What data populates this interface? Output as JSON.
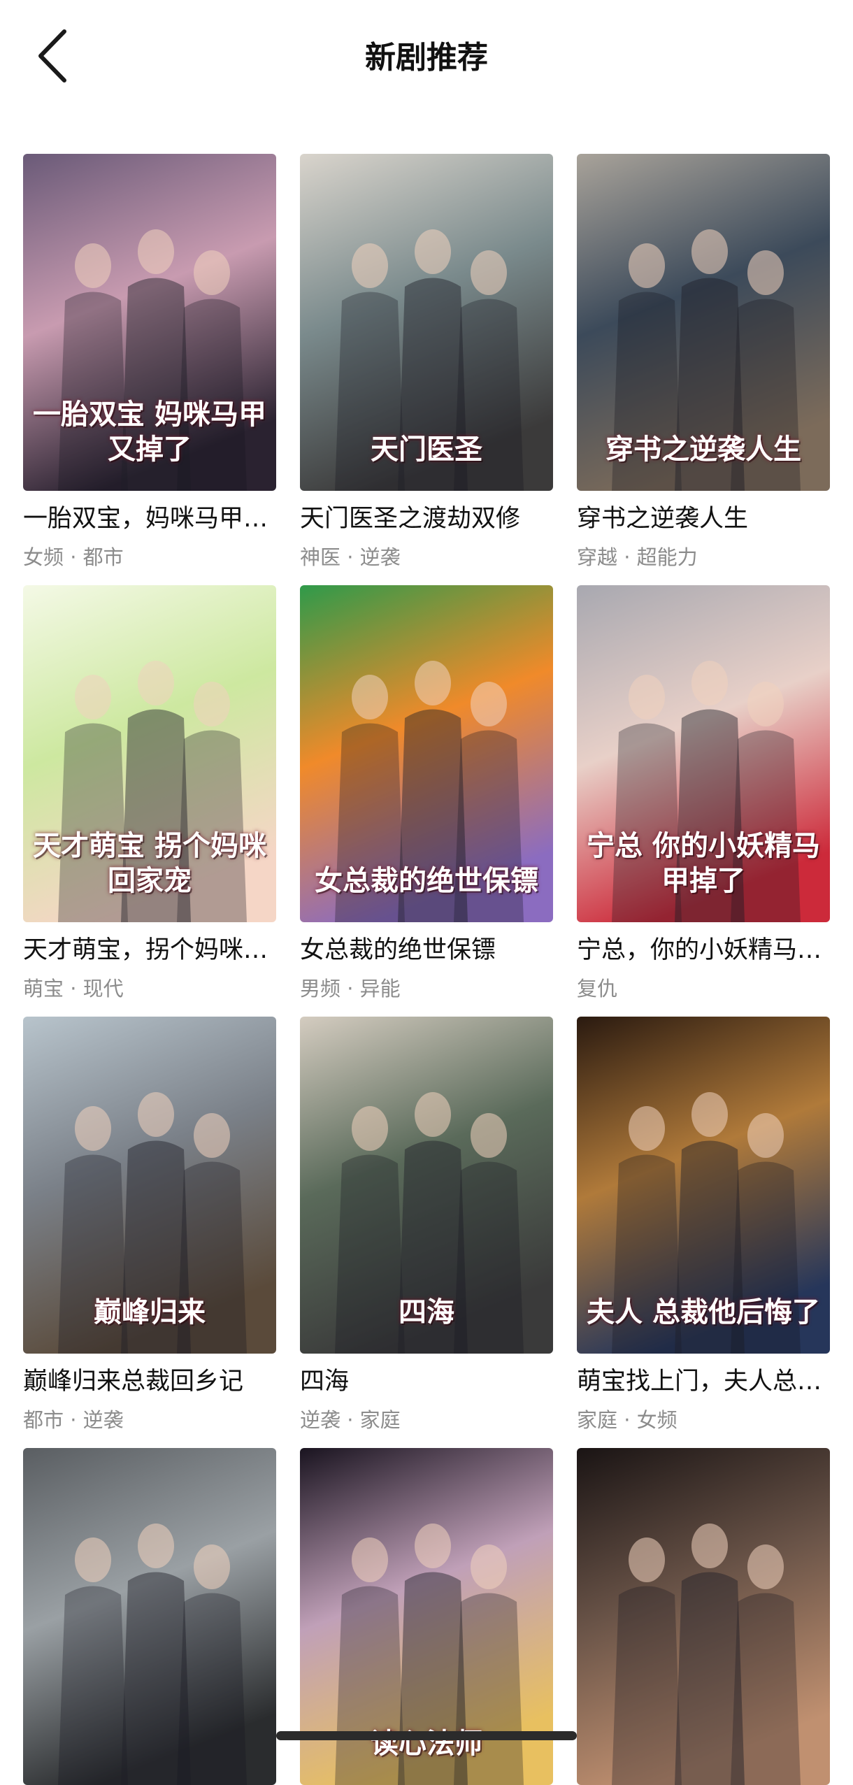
{
  "header": {
    "title": "新剧推荐",
    "back_icon": "chevron-left-icon"
  },
  "dramas": [
    {
      "title": "一胎双宝，妈咪马甲又掉了",
      "tags": "女频 · 都市",
      "poster_text": "一胎双宝 妈咪马甲又掉了",
      "colors": [
        "#6a5a78",
        "#c89bb0",
        "#2a2230"
      ]
    },
    {
      "title": "天门医圣之渡劫双修",
      "tags": "神医 · 逆袭",
      "poster_text": "天门医圣",
      "colors": [
        "#d9d4cc",
        "#7a8a8c",
        "#3b3a3a"
      ]
    },
    {
      "title": "穿书之逆袭人生",
      "tags": "穿越 · 超能力",
      "poster_text": "穿书之逆袭人生",
      "colors": [
        "#a9a39a",
        "#3c4a5a",
        "#7c6b5a"
      ]
    },
    {
      "title": "天才萌宝，拐个妈咪回家宠",
      "tags": "萌宝 · 现代",
      "poster_text": "天才萌宝 拐个妈咪回家宠",
      "colors": [
        "#f4f9e6",
        "#cde8a0",
        "#f5d6c6"
      ]
    },
    {
      "title": "女总裁的绝世保镖",
      "tags": "男频 · 异能",
      "poster_text": "女总裁的绝世保镖",
      "colors": [
        "#2f9a4a",
        "#f08a2a",
        "#8b6cc0"
      ]
    },
    {
      "title": "宁总，你的小妖精马甲掉了",
      "tags": "复仇",
      "poster_text": "宁总 你的小妖精马甲掉了",
      "colors": [
        "#a8a8b0",
        "#e8d0c8",
        "#cc2a3a"
      ]
    },
    {
      "title": "巅峰归来总裁回乡记",
      "tags": "都市 · 逆袭",
      "poster_text": "巅峰归来",
      "colors": [
        "#b8c4cc",
        "#7a8088",
        "#5a4a3a"
      ]
    },
    {
      "title": "四海",
      "tags": "逆袭 · 家庭",
      "poster_text": "四海",
      "colors": [
        "#d4ccc0",
        "#5a6a5a",
        "#3a3a3a"
      ]
    },
    {
      "title": "萌宝找上门，夫人总裁他后悔了",
      "tags": "家庭 · 女频",
      "poster_text": "夫人 总裁他后悔了",
      "colors": [
        "#2a1a10",
        "#b07a3a",
        "#26365a"
      ]
    },
    {
      "title": "",
      "tags": "",
      "poster_text": "",
      "colors": [
        "#5a5e62",
        "#9aa0a4",
        "#2a2c2e"
      ]
    },
    {
      "title": "",
      "tags": "",
      "poster_text": "读心法师",
      "colors": [
        "#1a1420",
        "#c0a0b8",
        "#e8c060"
      ]
    },
    {
      "title": "",
      "tags": "",
      "poster_text": "",
      "colors": [
        "#1a1414",
        "#6a5448",
        "#c09070"
      ]
    }
  ],
  "system": {
    "home_indicator": "home-indicator"
  }
}
